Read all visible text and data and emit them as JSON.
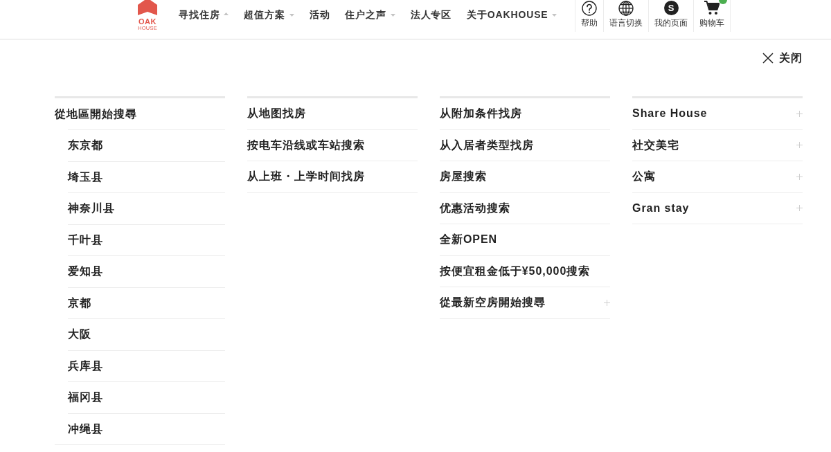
{
  "header": {
    "logo": {
      "line_1": "OAK",
      "line_2": "HOUSE"
    },
    "nav": [
      {
        "label": "寻找住房",
        "kind": "dropdown",
        "expanded": true
      },
      {
        "label": "超值方案",
        "kind": "dropdown",
        "expanded": false
      },
      {
        "label": "活动",
        "kind": "link"
      },
      {
        "label": "住户之声",
        "kind": "dropdown",
        "expanded": false
      },
      {
        "label": "法人专区",
        "kind": "link"
      },
      {
        "label": "关于OAKHOUSE",
        "kind": "dropdown",
        "expanded": false
      }
    ],
    "utility_links": [
      {
        "label": "帮助",
        "kind": "help"
      },
      {
        "label": "语言切换",
        "kind": "language"
      },
      {
        "label": "我的页面",
        "kind": "mypage",
        "icon_text": "S"
      },
      {
        "label": "购物车",
        "kind": "cart"
      }
    ]
  },
  "menu": {
    "close_label": "关闭",
    "columns": [
      {
        "items": [
          {
            "label": "從地區開始搜尋",
            "kind": "group",
            "expanded": true,
            "children": [
              {
                "label": "东京都"
              },
              {
                "label": "埼玉县"
              },
              {
                "label": "神奈川县"
              },
              {
                "label": "千叶县"
              },
              {
                "label": "爱知县"
              },
              {
                "label": "京都"
              },
              {
                "label": "大阪"
              },
              {
                "label": "兵库县"
              },
              {
                "label": "福冈县"
              },
              {
                "label": "冲绳县"
              }
            ]
          }
        ]
      },
      {
        "items": [
          {
            "label": "从地图找房",
            "kind": "link"
          },
          {
            "label": "按电车沿线或车站搜索",
            "kind": "link"
          },
          {
            "label": "从上班・上学时间找房",
            "kind": "link"
          }
        ]
      },
      {
        "items": [
          {
            "label": "从附加条件找房",
            "kind": "link"
          },
          {
            "label": "从入居者类型找房",
            "kind": "link"
          },
          {
            "label": "房屋搜索",
            "kind": "link"
          },
          {
            "label": "优惠活动搜索",
            "kind": "link"
          },
          {
            "label": "全新OPEN",
            "kind": "link"
          },
          {
            "label": "按便宜租金低于¥50,000搜索",
            "kind": "link"
          },
          {
            "label": "從最新空房開始搜尋",
            "kind": "group",
            "expanded": false
          }
        ]
      },
      {
        "items": [
          {
            "label": "Share House",
            "kind": "group",
            "expanded": false
          },
          {
            "label": "社交美宅",
            "kind": "group",
            "expanded": false
          },
          {
            "label": "公寓",
            "kind": "group",
            "expanded": false
          },
          {
            "label": "Gran stay",
            "kind": "group",
            "expanded": false
          }
        ]
      }
    ]
  }
}
